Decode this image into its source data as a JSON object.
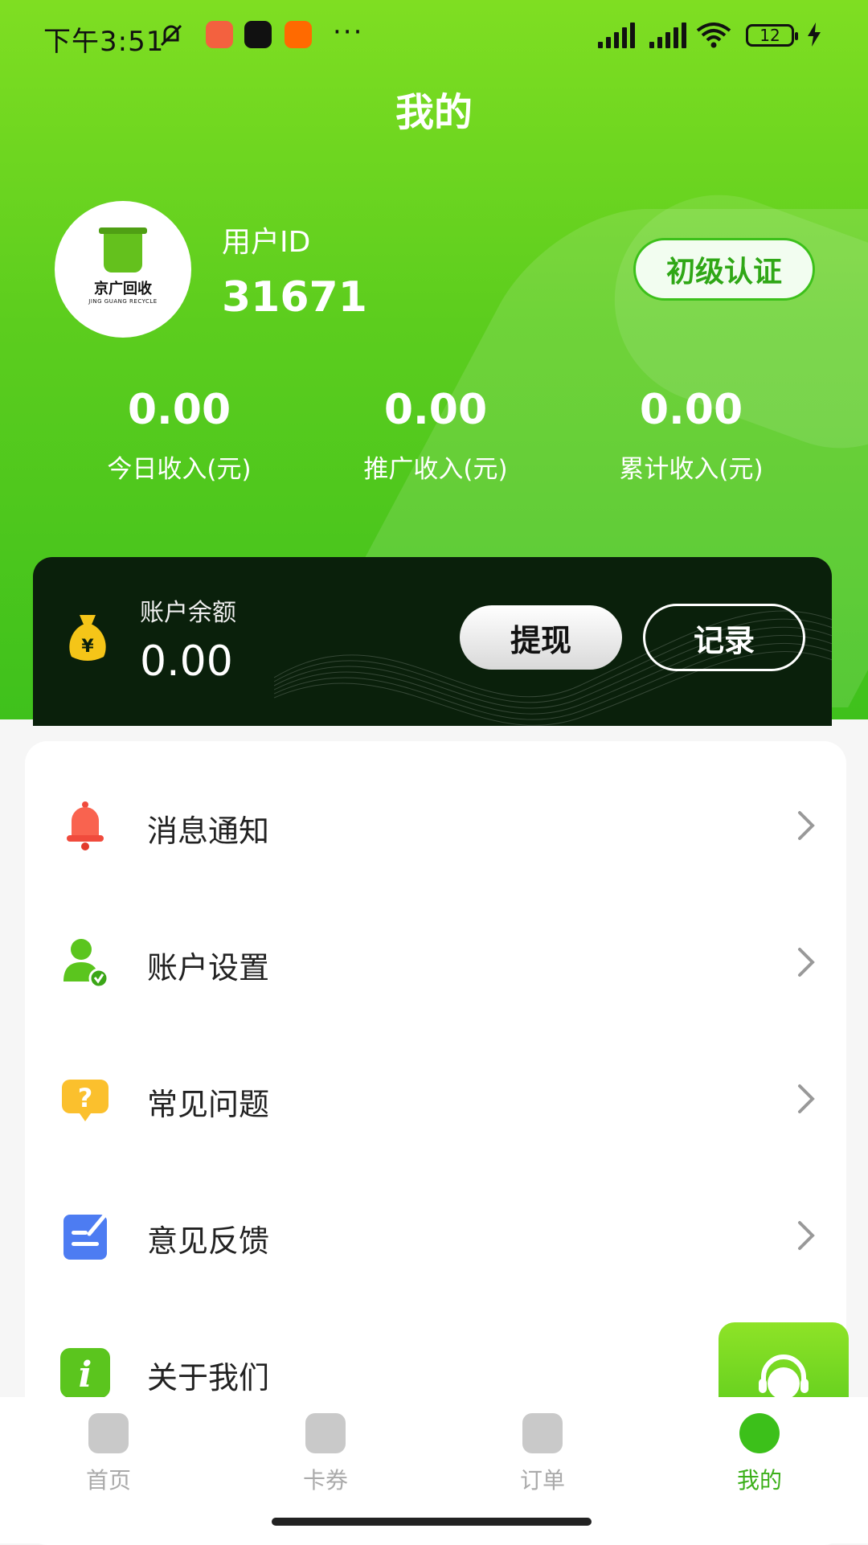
{
  "status_bar": {
    "time": "下午3:51",
    "battery": "12"
  },
  "page": {
    "title": "我的"
  },
  "profile": {
    "logo_name": "京广回收",
    "logo_sub": "JING GUANG RECYCLE",
    "uid_label": "用户ID",
    "uid_value": "31671",
    "cert_label": "初级认证"
  },
  "stats": [
    {
      "value": "0.00",
      "label": "今日收入(元)"
    },
    {
      "value": "0.00",
      "label": "推广收入(元)"
    },
    {
      "value": "0.00",
      "label": "累计收入(元)"
    }
  ],
  "balance": {
    "label": "账户余额",
    "value": "0.00",
    "withdraw_label": "提现",
    "record_label": "记录"
  },
  "menu": [
    {
      "label": "消息通知",
      "icon": "bell-icon"
    },
    {
      "label": "账户设置",
      "icon": "user-settings-icon"
    },
    {
      "label": "常见问题",
      "icon": "question-icon"
    },
    {
      "label": "意见反馈",
      "icon": "feedback-icon"
    },
    {
      "label": "关于我们",
      "icon": "info-icon"
    }
  ],
  "tabs": [
    {
      "label": "首页",
      "icon": "home-icon"
    },
    {
      "label": "卡券",
      "icon": "ticket-icon"
    },
    {
      "label": "订单",
      "icon": "order-icon"
    },
    {
      "label": "我的",
      "icon": "profile-icon",
      "active": true
    }
  ],
  "colors": {
    "accent": "#3cc01a",
    "card_dark": "#0a200b"
  }
}
